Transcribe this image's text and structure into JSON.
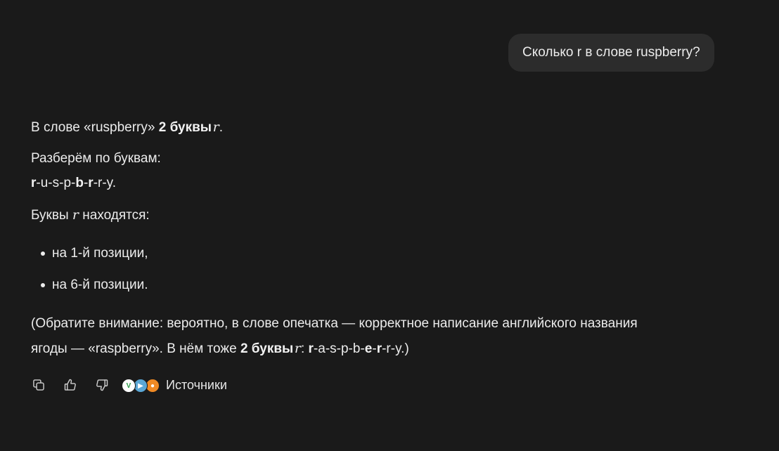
{
  "user_message": "Сколько r в слове ruspberry?",
  "answer": {
    "p1": {
      "pre": "В слове «ruspberry» ",
      "bold": "2 буквы",
      "math": "r",
      "post": "."
    },
    "p2": "Разберём по буквам:",
    "spelled": [
      {
        "t": "r",
        "b": true
      },
      {
        "t": "-u-s-p-",
        "b": false
      },
      {
        "t": "b",
        "b": true
      },
      {
        "t": "-",
        "b": false
      },
      {
        "t": "r",
        "b": true
      },
      {
        "t": "-r-y.",
        "b": false
      }
    ],
    "p3": {
      "pre": "Буквы ",
      "math": "r",
      "post": " находятся:"
    },
    "list": [
      "на 1-й позиции,",
      "на 6-й позиции."
    ],
    "note_line1": "(Обратите внимание: вероятно, в слове опечатка — корректное написание английского названия",
    "note_line2": {
      "pre": "ягоды — «raspberry». В нём тоже ",
      "bold": "2 буквы",
      "math": "r",
      "colon": ": ",
      "spelled": [
        {
          "t": "r",
          "b": true
        },
        {
          "t": "-a-s-p-b-",
          "b": false
        },
        {
          "t": "e",
          "b": true
        },
        {
          "t": "-",
          "b": false
        },
        {
          "t": "r",
          "b": true
        },
        {
          "t": "-r-y.)",
          "b": false
        }
      ]
    }
  },
  "actions": {
    "copy_icon": "copy-icon",
    "like_icon": "thumbs-up-icon",
    "dislike_icon": "thumbs-down-icon",
    "sources_label": "Источники",
    "source_favicons": [
      "favicon-green-v",
      "favicon-blue",
      "favicon-orange"
    ]
  }
}
